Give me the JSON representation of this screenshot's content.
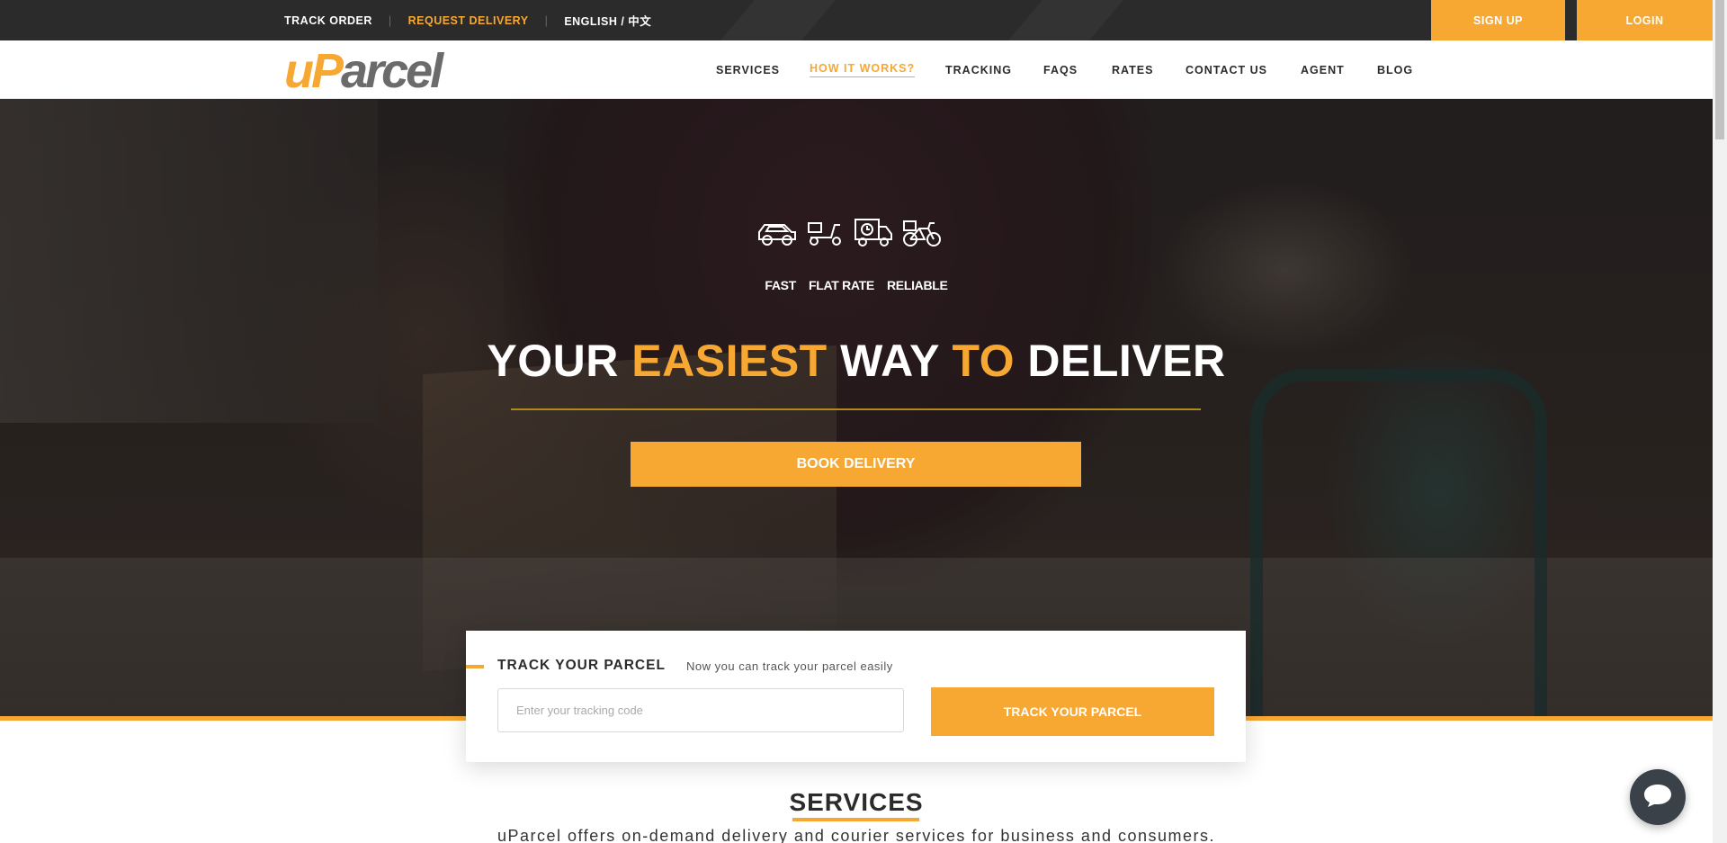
{
  "topbar": {
    "links": [
      "TRACK ORDER",
      "REQUEST DELIVERY",
      "ENGLISH / 中文"
    ],
    "signup_label": "SIGN UP",
    "login_label": "LOGIN",
    "accent_color": "#f7a833"
  },
  "logo": {
    "text_u": "u",
    "text_p": "P",
    "text_rest": "arcel"
  },
  "nav": {
    "items": [
      "SERVICES",
      "HOW IT WORKS?",
      "TRACKING",
      "FAQS",
      "RATES",
      "CONTACT US",
      "AGENT",
      "BLOG"
    ],
    "active": "HOW IT WORKS?"
  },
  "hero": {
    "icons": [
      "car-icon",
      "scooter-icon",
      "van-icon",
      "bicycle-icon"
    ],
    "taglines": [
      "FAST",
      "FLAT RATE",
      "RELIABLE"
    ],
    "headline_parts": [
      "YOUR",
      "EASIEST",
      "WAY",
      "TO",
      "DELIVER"
    ],
    "book_label": "BOOK DELIVERY"
  },
  "track": {
    "title": "TRACK YOUR PARCEL",
    "subtitle": "Now you can track your parcel easily",
    "input_placeholder": "Enter your tracking code",
    "input_value": "",
    "button_label": "TRACK YOUR PARCEL"
  },
  "services": {
    "title": "SERVICES",
    "description": "uParcel offers on-demand delivery and courier services for business and consumers."
  },
  "chat": {
    "icon": "chat-icon"
  }
}
